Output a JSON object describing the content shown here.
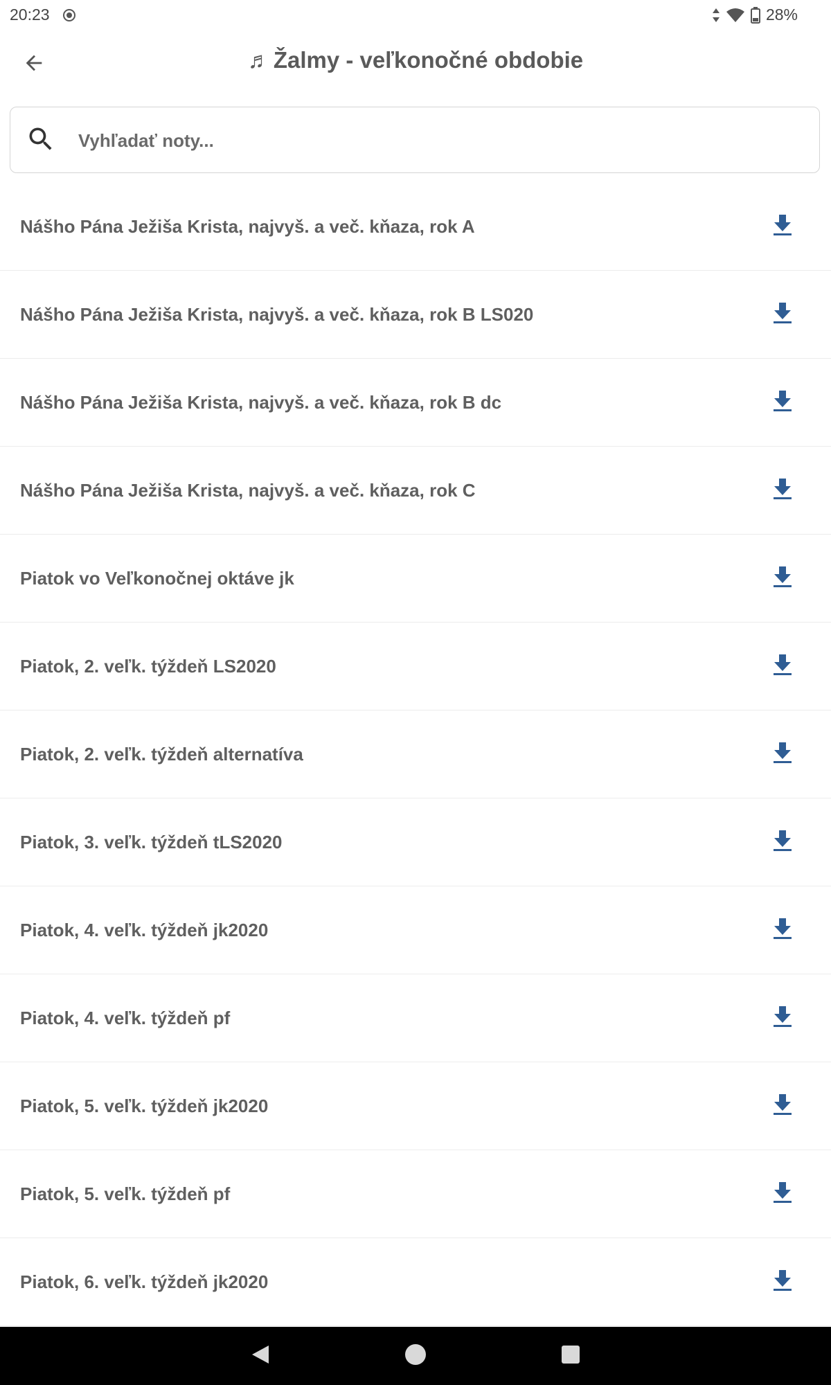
{
  "status_bar": {
    "time": "20:23",
    "battery": "28%"
  },
  "app_bar": {
    "note_glyph": "♬",
    "title": "Žalmy - veľkonočné obdobie"
  },
  "search": {
    "placeholder": "Vyhľadať noty..."
  },
  "colors": {
    "accent": "#2f5d94",
    "text": "#5f5f5f",
    "divider": "#ececec"
  },
  "items": [
    {
      "label": "Nášho Pána Ježiša Krista, najvyš. a več. kňaza, rok A",
      "icon": "download-icon"
    },
    {
      "label": "Nášho Pána Ježiša Krista, najvyš. a več. kňaza, rok B LS020",
      "icon": "download-icon"
    },
    {
      "label": "Nášho Pána Ježiša Krista, najvyš. a več. kňaza, rok B dc",
      "icon": "download-icon"
    },
    {
      "label": "Nášho Pána Ježiša Krista, najvyš. a več. kňaza, rok C",
      "icon": "download-icon"
    },
    {
      "label": "Piatok vo Veľkonočnej oktáve jk",
      "icon": "download-icon"
    },
    {
      "label": "Piatok, 2. veľk. týždeň LS2020",
      "icon": "download-icon"
    },
    {
      "label": "Piatok, 2. veľk. týždeň alternatíva",
      "icon": "download-icon"
    },
    {
      "label": "Piatok, 3. veľk. týždeň tLS2020",
      "icon": "download-icon"
    },
    {
      "label": "Piatok, 4. veľk. týždeň jk2020",
      "icon": "download-icon"
    },
    {
      "label": "Piatok, 4. veľk. týždeň pf",
      "icon": "download-icon"
    },
    {
      "label": "Piatok, 5. veľk. týždeň jk2020",
      "icon": "download-icon"
    },
    {
      "label": "Piatok, 5. veľk. týždeň pf",
      "icon": "download-icon"
    },
    {
      "label": "Piatok, 6. veľk. týždeň jk2020",
      "icon": "download-icon"
    }
  ]
}
